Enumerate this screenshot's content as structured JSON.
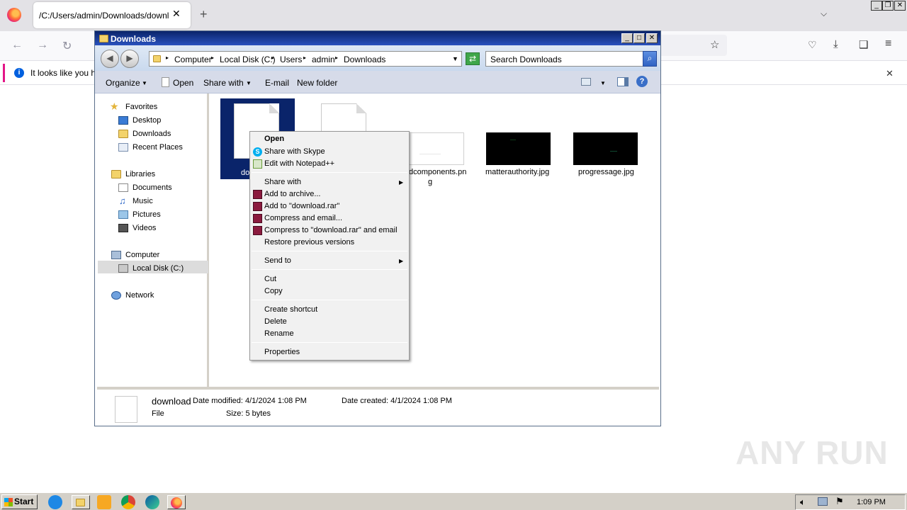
{
  "browser": {
    "tab_title": "/C:/Users/admin/Downloads/download",
    "tab_close": "✕",
    "new_tab": "+",
    "notice_text": "It looks like you ha",
    "notice_close": "✕"
  },
  "explorer": {
    "title": "Downloads",
    "breadcrumbs": [
      "Computer",
      "Local Disk (C:)",
      "Users",
      "admin",
      "Downloads"
    ],
    "search_placeholder": "Search Downloads",
    "toolbar": {
      "organize": "Organize",
      "open": "Open",
      "share_with": "Share with",
      "email": "E-mail",
      "new_folder": "New folder"
    },
    "nav": {
      "favorites": "Favorites",
      "desktop": "Desktop",
      "downloads": "Downloads",
      "recent_places": "Recent Places",
      "libraries": "Libraries",
      "documents": "Documents",
      "music": "Music",
      "pictures": "Pictures",
      "videos": "Videos",
      "computer": "Computer",
      "local_disk": "Local Disk (C:)",
      "network": "Network"
    },
    "files": {
      "download_partial": "do",
      "file3_name_line1": "dcomponents.pn",
      "file3_name_line2": "g",
      "file4_name": "matterauthority.jpg",
      "file5_name": "progressage.jpg"
    },
    "details": {
      "name": "download",
      "type": "File",
      "date_modified": "Date modified: 4/1/2024 1:08 PM",
      "date_created": "Date created: 4/1/2024 1:08 PM",
      "size": "Size: 5 bytes"
    }
  },
  "context_menu": {
    "items": [
      "Open",
      "Share with Skype",
      "Edit with Notepad++",
      "Share with",
      "Add to archive...",
      "Add to \"download.rar\"",
      "Compress and email...",
      "Compress to \"download.rar\" and email",
      "Restore previous versions",
      "Send to",
      "Cut",
      "Copy",
      "Create shortcut",
      "Delete",
      "Rename",
      "Properties"
    ]
  },
  "taskbar": {
    "start": "Start",
    "clock": "1:09 PM"
  },
  "watermark": "ANY RUN"
}
